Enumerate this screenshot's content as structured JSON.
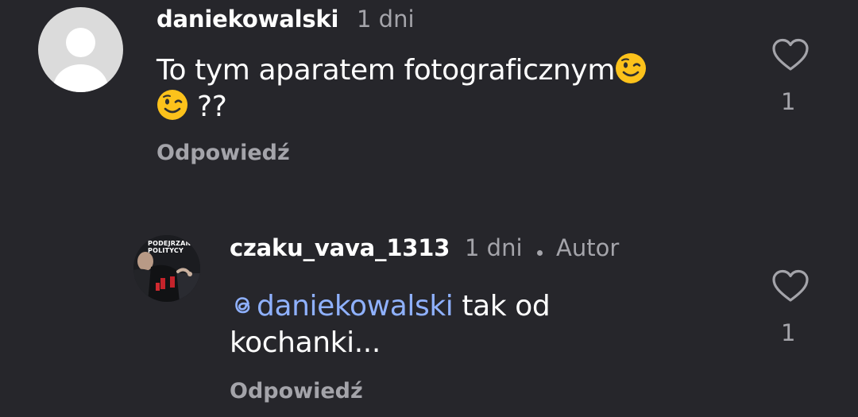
{
  "comments": [
    {
      "username": "daniekowalski",
      "time": "1 dni",
      "text_line1": "To tym aparatem fotograficznym",
      "text_line2": "??",
      "emoji": "winking-face",
      "reply_label": "Odpowiedź",
      "like_count": "1"
    },
    {
      "username": "czaku_vava_1313",
      "time": "1 dni",
      "badge": "Autor",
      "mention": "daniekowalski",
      "text_after_mention": " tak od",
      "text_line2": "kochanki...",
      "reply_label": "Odpowiedź",
      "like_count": "1",
      "avatar_text": "PODEJRZANI POLITYCY"
    }
  ],
  "colors": {
    "background": "#26262b",
    "muted": "#a4a4aa",
    "mention": "#8fb1ff"
  }
}
